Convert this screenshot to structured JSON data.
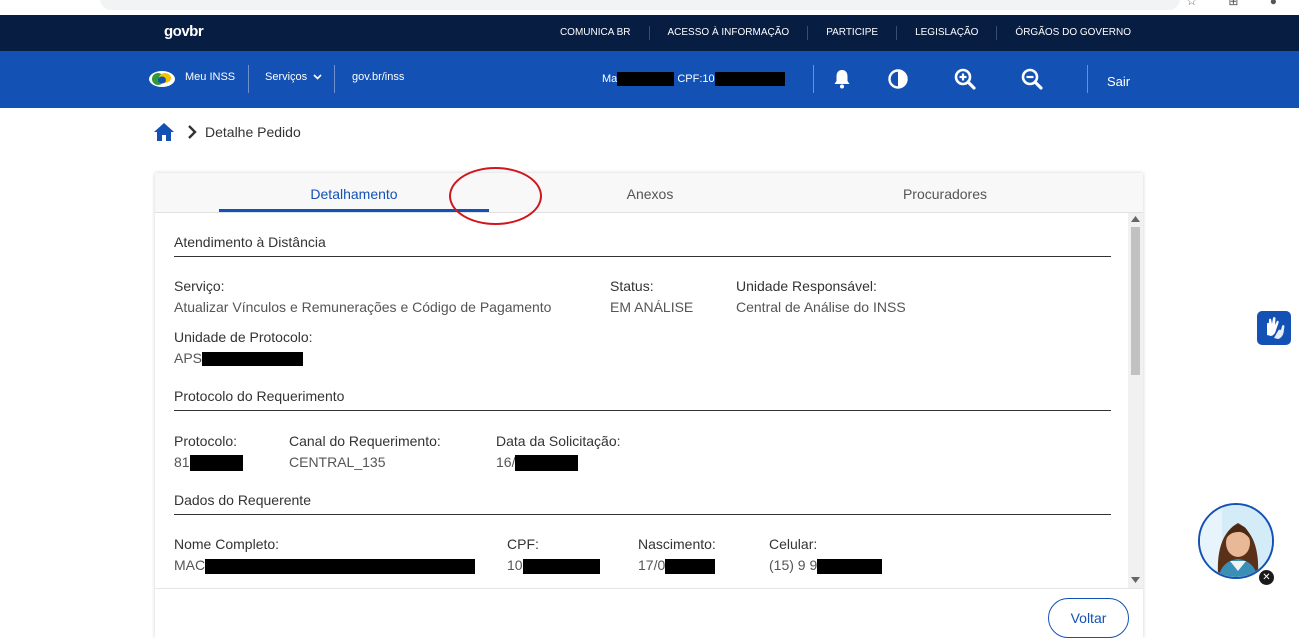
{
  "header": {
    "logo": "govbr",
    "top_links": [
      "COMUNICA BR",
      "ACESSO À INFORMAÇÃO",
      "PARTICIPE",
      "LEGISLAÇÃO",
      "ÓRGÃOS DO GOVERNO"
    ],
    "nav": {
      "meu_inss": "Meu INSS",
      "servicos": "Serviços",
      "govbr_inss": "gov.br/inss"
    },
    "user": {
      "name_prefix": "Ma",
      "cpf_prefix": "CPF:10"
    },
    "icons": [
      "bell-icon",
      "contrast-icon",
      "zoom-in-icon",
      "zoom-out-icon"
    ],
    "logout": "Sair"
  },
  "breadcrumb": {
    "current": "Detalhe Pedido"
  },
  "tabs": [
    {
      "label": "Detalhamento",
      "active": true
    },
    {
      "label": "Anexos",
      "active": false
    },
    {
      "label": "Procuradores",
      "active": false
    }
  ],
  "sections": {
    "atendimento": {
      "title": "Atendimento à Distância",
      "servico_label": "Serviço:",
      "servico_value": "Atualizar Vínculos e Remunerações e Código de Pagamento",
      "status_label": "Status:",
      "status_value": "EM ANÁLISE",
      "unidade_resp_label": "Unidade Responsável:",
      "unidade_resp_value": "Central de Análise do INSS",
      "unidade_prot_label": "Unidade de Protocolo:",
      "unidade_prot_value": "APS"
    },
    "protocolo": {
      "title": "Protocolo do Requerimento",
      "protocolo_label": "Protocolo:",
      "protocolo_value": "81",
      "canal_label": "Canal do Requerimento:",
      "canal_value": "CENTRAL_135",
      "data_label": "Data da Solicitação:",
      "data_value": "16/"
    },
    "requerente": {
      "title": "Dados do Requerente",
      "nome_label": "Nome Completo:",
      "nome_value": "MAC",
      "cpf_label": "CPF:",
      "cpf_value": "10",
      "nascimento_label": "Nascimento:",
      "nascimento_value": "17/0",
      "celular_label": "Celular:",
      "celular_value": "(15) 9 9"
    }
  },
  "footer": {
    "back_button": "Voltar"
  },
  "colors": {
    "topbar": "#071d41",
    "bluebar": "#1351b4",
    "annotation": "#d0161b"
  }
}
